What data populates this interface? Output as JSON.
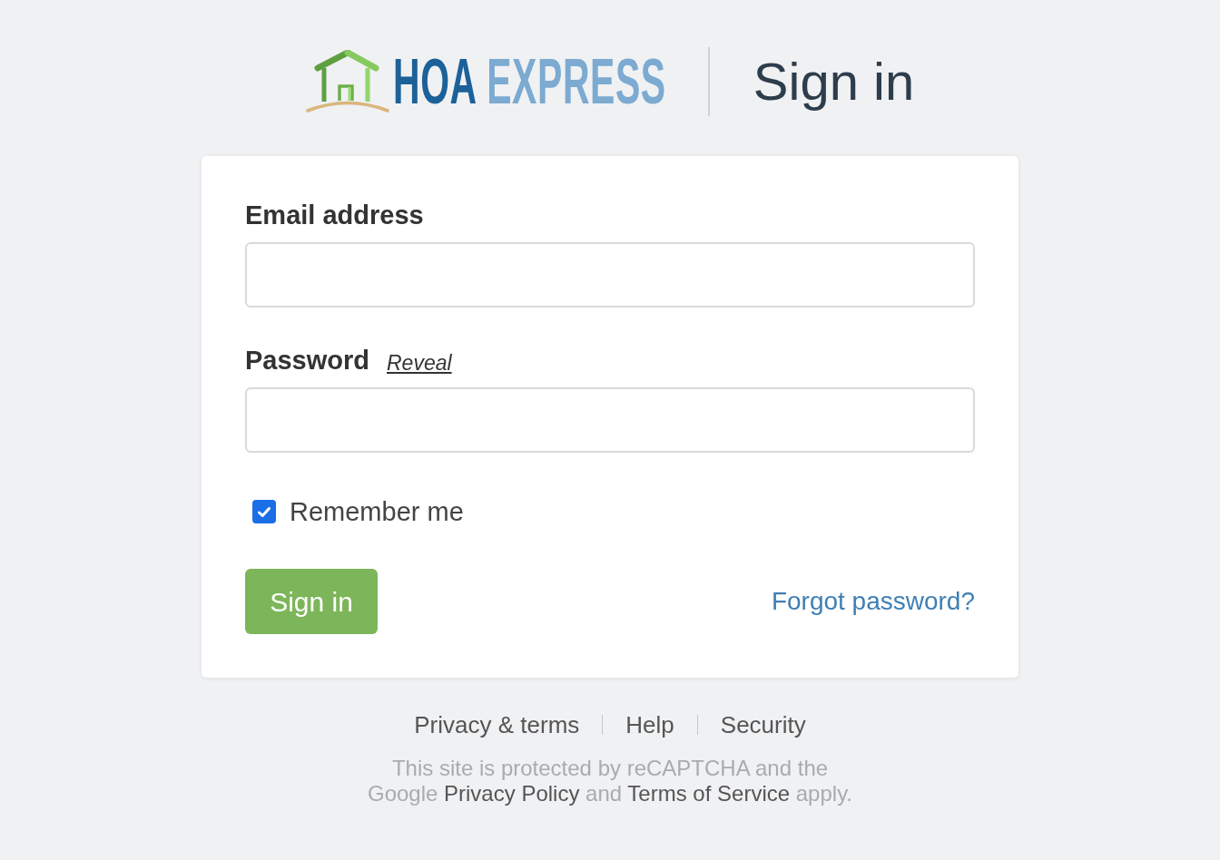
{
  "header": {
    "logo": {
      "primary": "HOA",
      "secondary": "EXPRESS"
    },
    "title": "Sign in"
  },
  "form": {
    "fields": [
      {
        "label": "Email address"
      },
      {
        "label": "Password",
        "action": "Reveal"
      }
    ],
    "remember": {
      "label": "Remember me",
      "checked": true
    },
    "submit": "Sign in",
    "forgot_link": "Forgot password?"
  },
  "footer": {
    "links": [
      "Privacy & terms",
      "Help",
      "Security"
    ],
    "recaptcha_notice": {
      "lines": [
        [
          {
            "kind": "text",
            "text": "This site is protected by reCAPTCHA and the"
          }
        ],
        [
          {
            "kind": "text",
            "text": "Google"
          },
          {
            "kind": "link",
            "text": "Privacy Policy"
          },
          {
            "kind": "text",
            "text": "and"
          },
          {
            "kind": "link",
            "text": "Terms of Service"
          },
          {
            "kind": "text",
            "text": "apply."
          }
        ]
      ]
    }
  }
}
